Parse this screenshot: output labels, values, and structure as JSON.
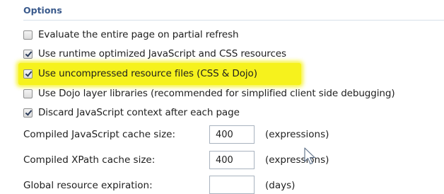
{
  "section": {
    "title": "Options"
  },
  "checkboxes": [
    {
      "label": "Evaluate the entire page on partial refresh",
      "checked": false
    },
    {
      "label": "Use runtime optimized JavaScript and CSS resources",
      "checked": true
    },
    {
      "label": "Use uncompressed resource files (CSS & Dojo)",
      "checked": true,
      "highlighted": true
    },
    {
      "label": "Use Dojo layer libraries (recommended for simplified client side debugging)",
      "checked": false
    },
    {
      "label": "Discard JavaScript context after each page",
      "checked": true
    }
  ],
  "fields": [
    {
      "label": "Compiled JavaScript cache size:",
      "value": "400",
      "unit": "(expressions)"
    },
    {
      "label": "Compiled XPath cache size:",
      "value": "400",
      "unit": "(expressions)"
    },
    {
      "label": "Global resource expiration:",
      "value": "",
      "unit": "(days)"
    }
  ],
  "colors": {
    "highlight": "#f6f21d",
    "section_title": "#3a5a8c"
  }
}
